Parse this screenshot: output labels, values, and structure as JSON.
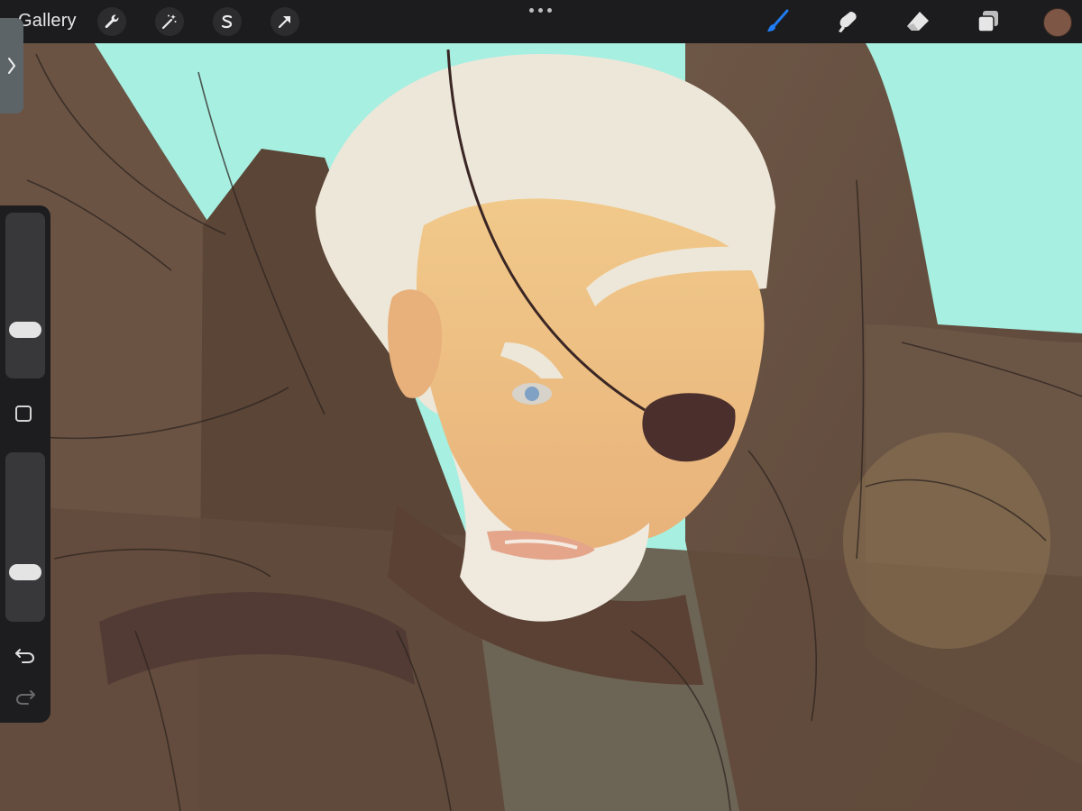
{
  "app": {
    "gallery_label": "Gallery"
  },
  "toolbar": {
    "left_tools": [
      {
        "icon": "wrench-icon",
        "name": "actions"
      },
      {
        "icon": "magic-wand-icon",
        "name": "adjustments"
      },
      {
        "icon": "selection-s-icon",
        "name": "selection"
      },
      {
        "icon": "arrow-cursor-icon",
        "name": "transform"
      }
    ],
    "more_icon": "ellipsis-icon",
    "right_tools": [
      {
        "icon": "brush-icon",
        "name": "paint",
        "active": true
      },
      {
        "icon": "smudge-icon",
        "name": "smudge"
      },
      {
        "icon": "eraser-icon",
        "name": "erase"
      },
      {
        "icon": "layers-icon",
        "name": "layers"
      }
    ],
    "active_color": "#7e5646",
    "accent_color": "#1f7cf2"
  },
  "sidebar": {
    "toggle_icon": "chevron-right-icon",
    "brush_size_level": 0.26,
    "opacity_level": 0.26,
    "modify_icon": "square-icon",
    "undo_icon": "undo-icon",
    "redo_icon": "redo-icon"
  },
  "canvas": {
    "background_color": "#a6efe1",
    "subject": "illustration-work-in-progress"
  }
}
